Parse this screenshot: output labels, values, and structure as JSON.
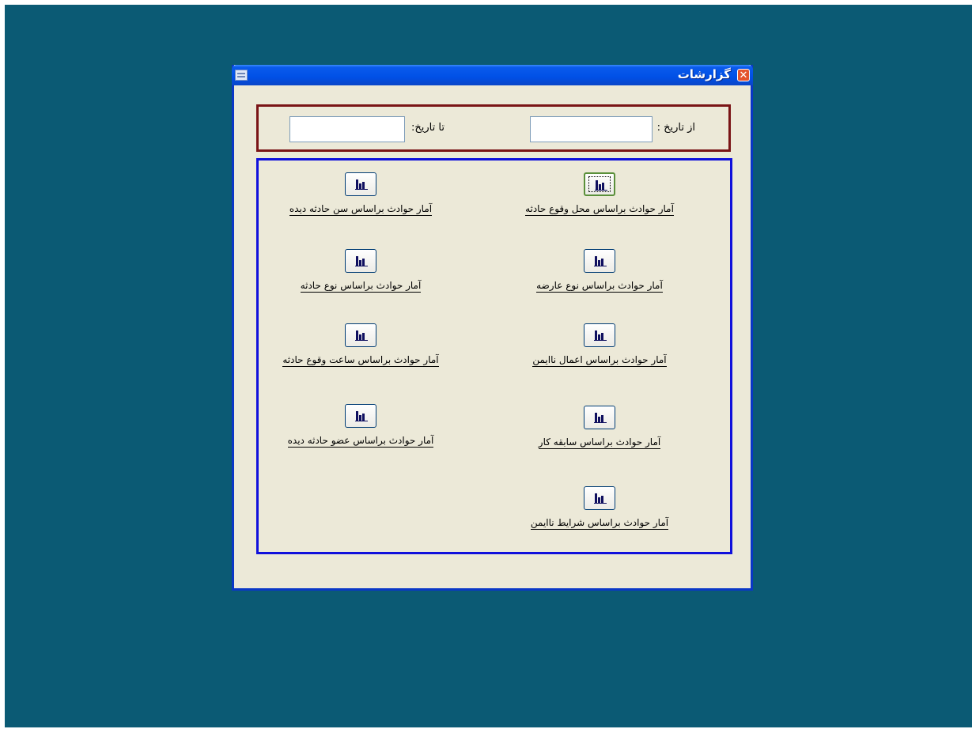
{
  "window": {
    "title": "گزارشات",
    "close_glyph": "✕"
  },
  "dates": {
    "from_label": "از تاریخ :",
    "to_label": "تا تاریخ:",
    "from_value": "",
    "to_value": ""
  },
  "reports": [
    {
      "label": "آمار حوادث براساس محل وقوع حادثه"
    },
    {
      "label": "آمار حوادث براساس سن حادثه دیده"
    },
    {
      "label": "آمار حوادث براساس  نوع عارضه"
    },
    {
      "label": "آمار حوادث براساس  نوع حادثه"
    },
    {
      "label": "آمار حوادث براساس اعمال ناایمن"
    },
    {
      "label": "آمار حوادث براساس ساعت وقوع حادثه"
    },
    {
      "label": "آمار حوادث براساس سابقه کار"
    },
    {
      "label": "آمار حوادث براساس عضو حادثه دیده"
    },
    {
      "label": "آمار حوادث براساس  شرایط ناایمن"
    }
  ],
  "colors": {
    "desktop": "#0b5a74",
    "window_bg": "#ece9d8",
    "date_frame_border": "#7a1416",
    "report_frame_border": "#1010dc"
  },
  "icons": {
    "report_button": "bar-chart-icon",
    "system_menu": "window-menu-icon"
  }
}
